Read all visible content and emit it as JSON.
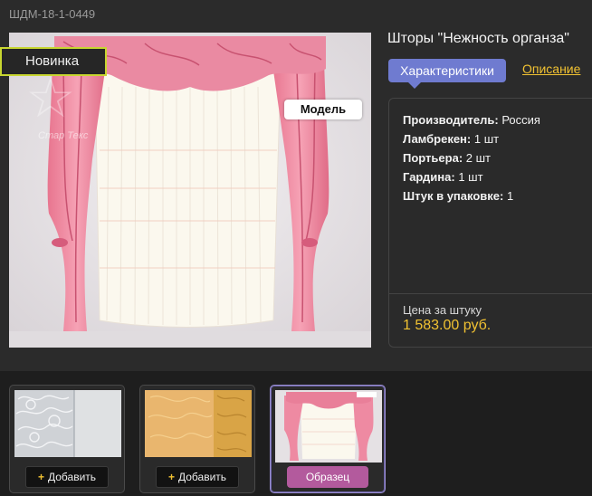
{
  "product": {
    "sku": "ШДМ-18-1-0449",
    "title": "Шторы \"Нежность органза\"",
    "badge_new": "Новинка",
    "badge_model": "Модель",
    "watermark": "Стар Текс"
  },
  "tabs": {
    "active": "Характеристики",
    "inactive": "Описание"
  },
  "specs": [
    {
      "label": "Производитель:",
      "value": "Россия"
    },
    {
      "label": "Ламбрекен:",
      "value": "1 шт"
    },
    {
      "label": "Портьера:",
      "value": "2 шт"
    },
    {
      "label": "Гардина:",
      "value": "1 шт"
    },
    {
      "label": "Штук в упаковке:",
      "value": "1"
    }
  ],
  "price": {
    "label": "Цена за штуку",
    "value": "1 583.00 руб."
  },
  "thumbnails": [
    {
      "button": "Добавить",
      "button_icon": "plus-icon"
    },
    {
      "button": "Добавить",
      "button_icon": "plus-icon"
    },
    {
      "button": "Образец"
    }
  ],
  "colors": {
    "accent_tab": "#6f7bd0",
    "price": "#f1c232",
    "badge_border": "#c8d630",
    "sample_button": "#b35a9d"
  }
}
